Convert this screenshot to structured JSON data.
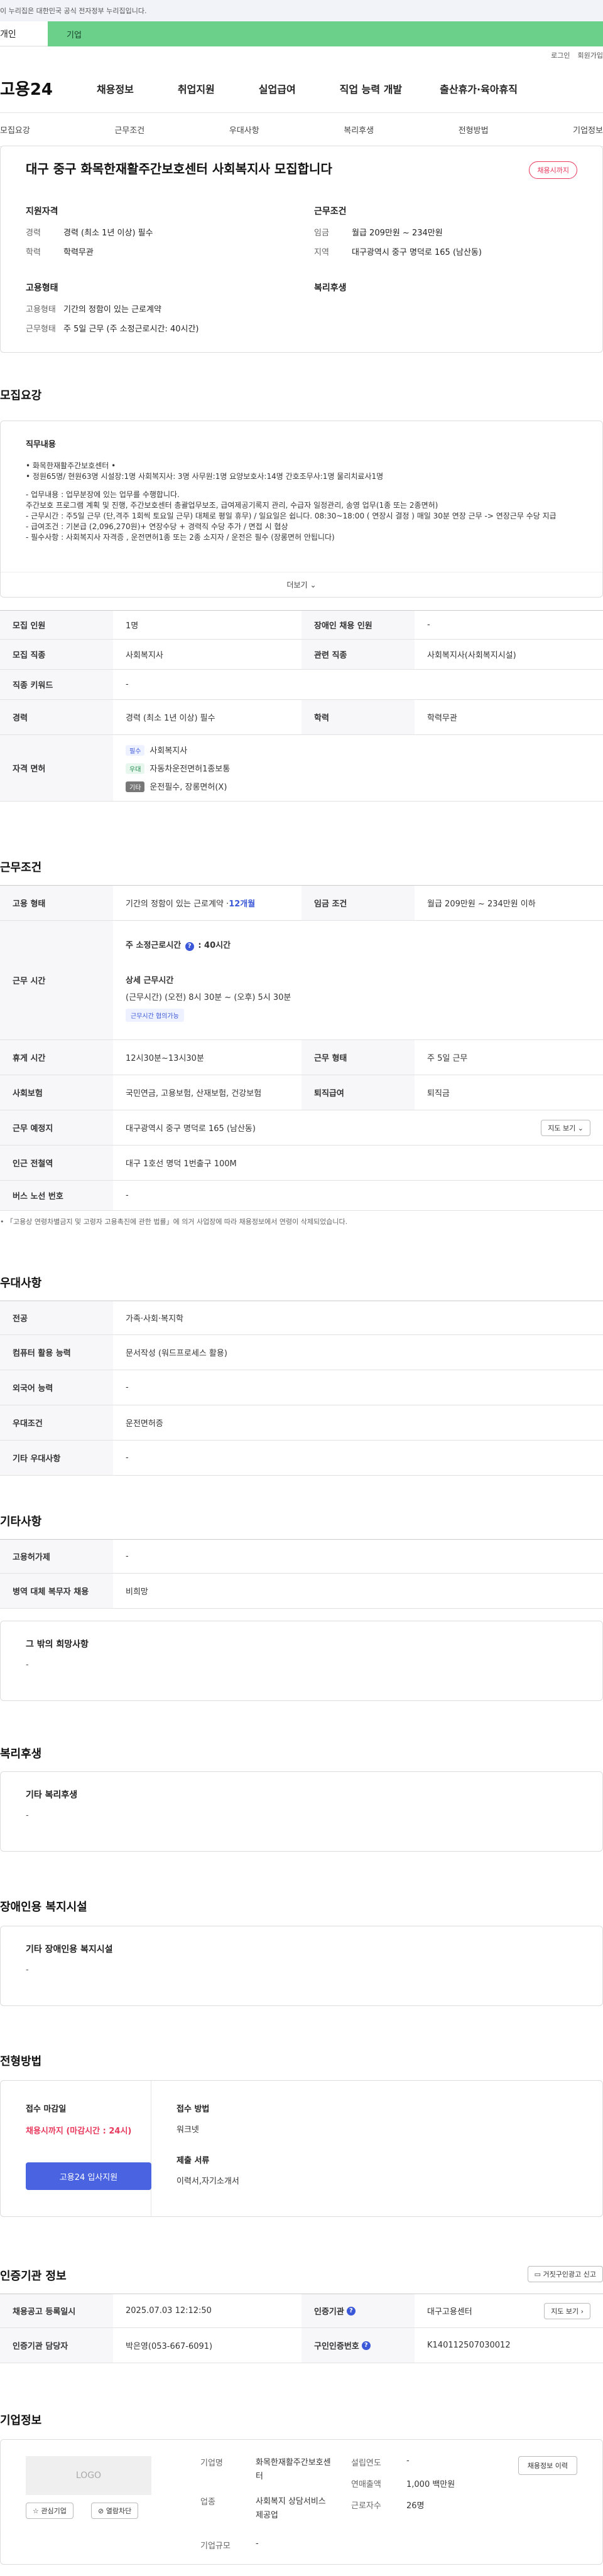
{
  "gov_banner": "이 누리집은 대한민국 공식 전자정부 누리집입니다.",
  "site_tabs": {
    "individual": "개인",
    "business": "기업"
  },
  "util_links": {
    "login": "로그인",
    "signup": "회원가입"
  },
  "logo": "고용24",
  "gnb": [
    "채용정보",
    "취업지원",
    "실업급여",
    "직업 능력 개발",
    "출산휴가·육아휴직"
  ],
  "anchors": [
    "모집요강",
    "근무조건",
    "우대사항",
    "복리후생",
    "전형방법",
    "기업정보"
  ],
  "summary": {
    "title": "대구 중구 화목한재활주간보호센터 사회복지사 모집합니다",
    "badge": "채용시까지",
    "qual_heading": "지원자격",
    "cond_heading": "근무조건",
    "career_label": "경력",
    "career_value": "경력 (최소 1년 이상) 필수",
    "edu_label": "학력",
    "edu_value": "학력무관",
    "wage_label": "임금",
    "wage_value": "월급 209만원 ~ 234만원",
    "region_label": "지역",
    "region_value": "대구광역시 중구 명덕로 165 (남산동)",
    "emp_heading": "고용형태",
    "welfare_heading": "복리후생",
    "emptype_label": "고용형태",
    "emptype_value": "기간의 정함이 있는 근로계약",
    "worktype_label": "근무형태",
    "worktype_value": "주 5일 근무 (주 소정근로시간: 40시간)"
  },
  "recruit": {
    "title": "모집요강",
    "duty_heading": "직무내용",
    "duty_lines": [
      "• 화목한재활주간보호센터 •",
      "• 정원65명/ 현원63명  시설장:1명 사회복지사: 3명 사무원:1명 요양보호사:14명 간호조무사:1명 물리치료사1명",
      "",
      "- 업무내용 : 업무분장에 있는 업무를 수행합니다.",
      "주간보호 프로그램 계획 및 진행, 주간보호센터 총괄업무보조, 급여제공기록지 관리,  수급자 일정관리,  송영 업무(1종 또는 2종면허)",
      "- 근무시간 : 주5일 근무 (단,격주 1회씩 토요일 근무) 대체로 평일 휴무) / 일요일은 쉽니다. 08:30~18:00 ( 연장시 결정 )  매일 30분 연장 근무 -> 연장근무 수당 지급",
      "- 급여조건 : 기본급 (2,096,270원)+ 연장수당 + 경력직 수당 추가  / 면접 시 협상",
      "- 필수사항 : 사회복지사 자격증 , 운전면허1종 또는 2종 소지자 / 운전은 필수 (장롱면허 안됩니다)"
    ],
    "more": "더보기",
    "rows": {
      "count_label": "모집 인원",
      "count_value": "1명",
      "disabled_label": "장애인 채용 인원",
      "disabled_value": "-",
      "job_label": "모집 직종",
      "job_value": "사회복지사",
      "rel_label": "관련 직종",
      "rel_value": "사회복지사(사회복지시설)",
      "kw_label": "직종 키워드",
      "kw_value": "-",
      "career_label": "경력",
      "career_value": "경력 (최소 1년 이상) 필수",
      "edu_label": "학력",
      "edu_value": "학력무관",
      "license_label": "자격 면허",
      "license_items": [
        {
          "tag": "필수",
          "text": "사회복지사"
        },
        {
          "tag": "우대",
          "text": "자동차운전면허1종보통"
        },
        {
          "tag": "기타",
          "text": "운전필수, 장롱면허(X)"
        }
      ]
    }
  },
  "conditions": {
    "title": "근무조건",
    "emptype_label": "고용 형태",
    "emptype_value": "기간의 정함이 있는 근로계약 · ",
    "emptype_months": "12개월",
    "wage_label": "임금 조건",
    "wage_value": "월급 209만원 ~ 234만원 이하",
    "hours_label": "근무 시간",
    "hours_weekly_label": "주 소정근로시간",
    "hours_weekly_value": ": 40시간",
    "hours_detail_label": "상세 근무시간",
    "hours_detail_value": "(근무시간) (오전) 8시 30분 ~ (오후) 5시 30분",
    "hours_badge": "근무시간 협의가능",
    "break_label": "휴게 시간",
    "break_value": "12시30분~13시30분",
    "form_label": "근무 형태",
    "form_value": "주 5일 근무",
    "insurance_label": "사회보험",
    "insurance_value": "국민연금, 고용보험, 산재보험, 건강보험",
    "severance_label": "퇴직급여",
    "severance_value": "퇴직금",
    "place_label": "근무 예정지",
    "place_value": "대구광역시 중구 명덕로 165 (남산동)",
    "map_button": "지도 보기",
    "subway_label": "인근 전철역",
    "subway_value": "대구 1호선 명덕 1번출구 100M",
    "bus_label": "버스 노선 번호",
    "bus_value": "-",
    "note": "• 「고용상 연령차별금지 및 고령자 고용촉진에 관한 법률」에 의거 사업장에 따라 채용정보에서 연령이 삭제되었습니다."
  },
  "preferences": {
    "title": "우대사항",
    "major_label": "전공",
    "major_value": "가족·사회·복지학",
    "computer_label": "컴퓨터 활용 능력",
    "computer_value": "문서작성 (워드프로세스 활용)",
    "lang_label": "외국어 능력",
    "lang_value": "-",
    "pref_label": "우대조건",
    "pref_value": "운전면허증",
    "etc_label": "기타 우대사항",
    "etc_value": "-"
  },
  "others": {
    "title": "기타사항",
    "employ_label": "고용허가제",
    "employ_value": "-",
    "military_label": "병역 대체 복무자 채용",
    "military_value": "비희망",
    "wish_heading": "그 밖의 희망사항",
    "wish_value": "-"
  },
  "welfare": {
    "title": "복리후생",
    "heading": "기타 복리후생",
    "value": "-"
  },
  "disabled_fac": {
    "title": "장애인용 복지시설",
    "heading": "기타 장애인용 복지시설",
    "value": "-"
  },
  "selection": {
    "title": "전형방법",
    "deadline_label": "접수 마감일",
    "deadline_value": "채용시까지 (마감시간 : 24시)",
    "apply_button": "고용24 입사지원",
    "method_label": "접수 방법",
    "method_value": "워크넷",
    "docs_label": "제출 서류",
    "docs_value": "이력서,자기소개서"
  },
  "auth": {
    "title": "인증기관 정보",
    "report_button": "거짓구인광고 신고",
    "date_label": "채용공고 등록일시",
    "date_value": "2025.07.03 12:12:50",
    "org_label": "인증기관",
    "org_value": "대구고용센터",
    "map_button": "지도 보기",
    "manager_label": "인증기관 담당자",
    "manager_value": "박은영(053-667-6091)",
    "reqno_label": "구인인증번호",
    "reqno_value": "K140112507030012"
  },
  "company": {
    "title": "기업정보",
    "logo_text": "LOGO",
    "fav_button": "관심기업",
    "block_button": "열람차단",
    "name_label": "기업명",
    "name_value": "화목한재활주간보호센터",
    "industry_label": "업종",
    "industry_value": "사회복지 상담서비스 제공업",
    "size_label": "기업규모",
    "size_value": "-",
    "founded_label": "설립연도",
    "founded_value": "-",
    "sales_label": "연매출액",
    "sales_value": "1,000 백만원",
    "staff_label": "근로자수",
    "staff_value": "26명",
    "history_button": "채용정보 이력"
  }
}
